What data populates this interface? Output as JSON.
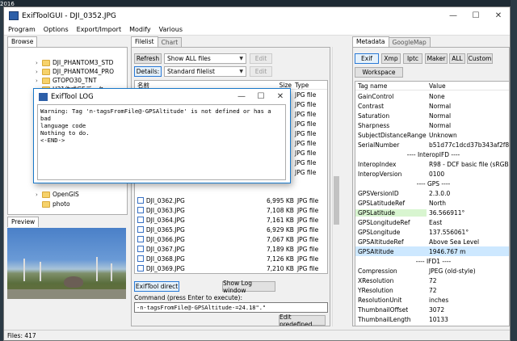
{
  "desktop": {
    "year_text": "2016"
  },
  "window": {
    "title": "ExifToolGUI - DJI_0352.JPG",
    "minimize": "—",
    "maximize": "☐",
    "close": "✕"
  },
  "menu": [
    "Program",
    "Options",
    "Export/Import",
    "Modify",
    "Various"
  ],
  "browse": {
    "tab": "Browse",
    "tree": [
      {
        "label": "DJI_PHANTOM3_STD",
        "chevron": "›"
      },
      {
        "label": "DJI_PHANTOM4_PRO",
        "chevron": "›"
      },
      {
        "label": "GTOPO30_TNT",
        "chevron": "›"
      },
      {
        "label": "H21作成GEデータ",
        "chevron": "›"
      },
      {
        "label": "OpenGIS",
        "chevron": "›"
      },
      {
        "label": "photo",
        "chevron": ""
      }
    ]
  },
  "preview": {
    "tab": "Preview"
  },
  "status": {
    "files": "Files: 417"
  },
  "filelist": {
    "tabs": [
      "Filelist",
      "Chart"
    ],
    "refresh": "Refresh",
    "filter": "Show ALL files",
    "edit": "Edit",
    "details": "Details:",
    "view": "Standard filelist",
    "col_name": "名前",
    "col_size": "Size",
    "col_type": "Type",
    "hidden_types": [
      "JPG file",
      "JPG file",
      "JPG file",
      "JPG file",
      "JPG file",
      "JPG file",
      "JPG file",
      "JPG file",
      "JPG file"
    ],
    "rows": [
      {
        "name": "DJI_0362.JPG",
        "size": "6,995 KB",
        "type": "JPG file"
      },
      {
        "name": "DJI_0363.JPG",
        "size": "7,108 KB",
        "type": "JPG file"
      },
      {
        "name": "DJI_0364.JPG",
        "size": "7,161 KB",
        "type": "JPG file"
      },
      {
        "name": "DJI_0365.JPG",
        "size": "6,929 KB",
        "type": "JPG file"
      },
      {
        "name": "DJI_0366.JPG",
        "size": "7,067 KB",
        "type": "JPG file"
      },
      {
        "name": "DJI_0367.JPG",
        "size": "7,189 KB",
        "type": "JPG file"
      },
      {
        "name": "DJI_0368.JPG",
        "size": "7,126 KB",
        "type": "JPG file"
      },
      {
        "name": "DJI_0369.JPG",
        "size": "7,210 KB",
        "type": "JPG file"
      }
    ],
    "exiftool_direct": "ExifTool direct",
    "show_log": "Show Log window",
    "cmd_label": "Command (press Enter to execute):",
    "cmd_value": "-n-tagsFromFile@-GPSAltitude-=24.18\".\"",
    "edit_predefined": "Edit predefined"
  },
  "log": {
    "title": "ExifTool LOG",
    "text": "Warning: Tag 'n-tagsFromFile@-GPSAltitude' is not defined or has a bad\nlanguage code\nNothing to do.\n<-END->"
  },
  "metadata": {
    "tabs": [
      "Metadata",
      "GoogleMap"
    ],
    "buttons": [
      "Exif",
      "Xmp",
      "Iptc",
      "Maker",
      "ALL",
      "Custom"
    ],
    "workspace": "Workspace",
    "col_tag": "Tag name",
    "col_value": "Value",
    "rows": [
      {
        "tag": "GainControl",
        "value": "None"
      },
      {
        "tag": "Contrast",
        "value": "Normal"
      },
      {
        "tag": "Saturation",
        "value": "Normal"
      },
      {
        "tag": "Sharpness",
        "value": "Normal"
      },
      {
        "tag": "SubjectDistanceRange",
        "value": "Unknown"
      },
      {
        "tag": "SerialNumber",
        "value": "b51d77c1dcd37b343af2f836"
      },
      {
        "section": "---- InteropIFD ----"
      },
      {
        "tag": "InteropIndex",
        "value": "R98 - DCF basic file (sRGB)"
      },
      {
        "tag": "InteropVersion",
        "value": "0100"
      },
      {
        "section": "---- GPS ----"
      },
      {
        "tag": "GPSVersionID",
        "value": "2.3.0.0"
      },
      {
        "tag": "GPSLatitudeRef",
        "value": "North"
      },
      {
        "tag": "GPSLatitude",
        "value": "36.566911°",
        "hl": "green"
      },
      {
        "tag": "GPSLongitudeRef",
        "value": "East"
      },
      {
        "tag": "GPSLongitude",
        "value": "137.556061°"
      },
      {
        "tag": "GPSAltitudeRef",
        "value": "Above Sea Level"
      },
      {
        "tag": "GPSAltitude",
        "value": "1946.767 m",
        "hl": "blue"
      },
      {
        "section": "---- IFD1 ----"
      },
      {
        "tag": "Compression",
        "value": "JPEG (old-style)"
      },
      {
        "tag": "XResolution",
        "value": "72"
      },
      {
        "tag": "YResolution",
        "value": "72"
      },
      {
        "tag": "ResolutionUnit",
        "value": "inches"
      },
      {
        "tag": "ThumbnailOffset",
        "value": "3072"
      },
      {
        "tag": "ThumbnailLength",
        "value": "10133"
      }
    ]
  }
}
